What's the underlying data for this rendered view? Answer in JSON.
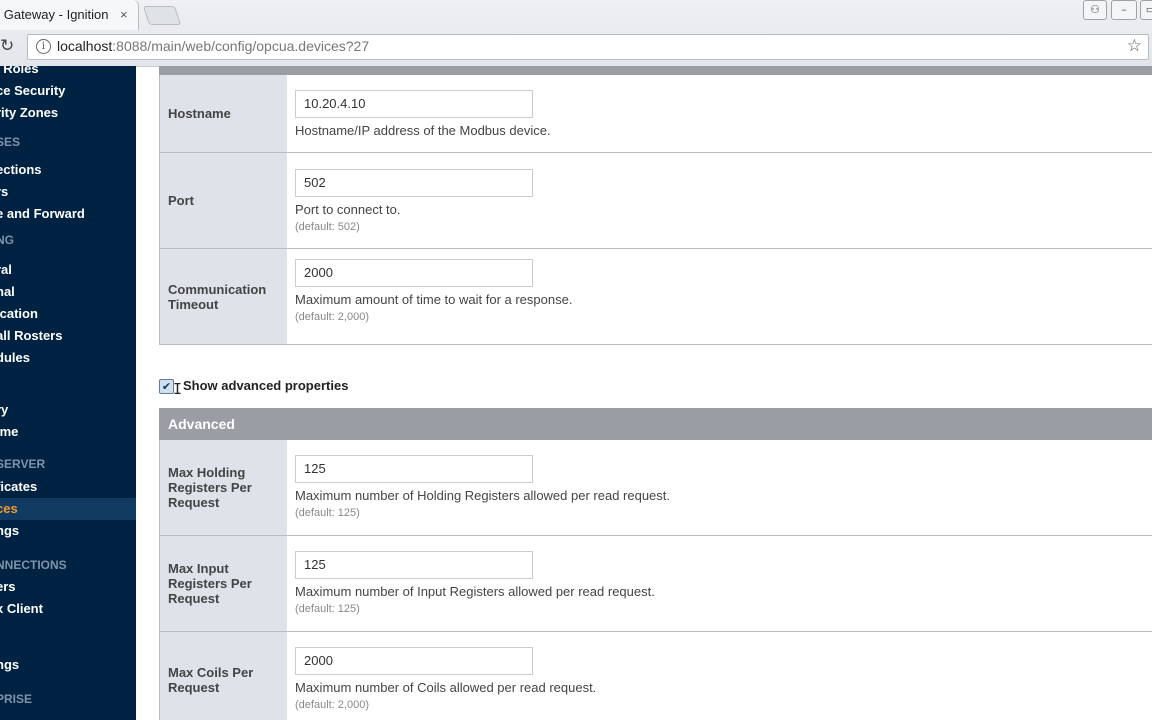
{
  "browser": {
    "tab_title": "al Gateway - Ignition",
    "tab_close": "×",
    "url_host": "localhost",
    "url_rest": ":8088/main/web/config/opcua.devices?27",
    "reload_glyph": "↻",
    "star_glyph": "☆",
    "info_glyph": "i",
    "profile_glyph": "⚇",
    "minimize_glyph": "–",
    "maximize_glyph": "▭",
    "close_glyph": "✕"
  },
  "sidebar": {
    "items": [
      {
        "label": ", Roles",
        "type": "link"
      },
      {
        "label": "ce Security",
        "type": "link"
      },
      {
        "label": "rity Zones",
        "type": "link"
      },
      {
        "label": "SES",
        "type": "header"
      },
      {
        "label": "ections",
        "type": "link"
      },
      {
        "label": "rs",
        "type": "link"
      },
      {
        "label": "e and Forward",
        "type": "link"
      },
      {
        "label": "NG",
        "type": "header"
      },
      {
        "label": "ral",
        "type": "link"
      },
      {
        "label": "nal",
        "type": "link"
      },
      {
        "label": "ication",
        "type": "link"
      },
      {
        "label": "all Rosters",
        "type": "link"
      },
      {
        "label": "dules",
        "type": "link"
      },
      {
        "label": "ry",
        "type": "link"
      },
      {
        "label": "ime",
        "type": "link"
      },
      {
        "label": " SERVER",
        "type": "header"
      },
      {
        "label": "ficates",
        "type": "link"
      },
      {
        "label": "ces",
        "type": "active"
      },
      {
        "label": "ngs",
        "type": "link"
      },
      {
        "label": "NNECTIONS",
        "type": "header"
      },
      {
        "label": "ers",
        "type": "link"
      },
      {
        "label": "x Client",
        "type": "link"
      },
      {
        "label": "ngs",
        "type": "link"
      },
      {
        "label": "PRISE",
        "type": "header"
      }
    ]
  },
  "form": {
    "rows": [
      {
        "label": "Hostname",
        "value": "10.20.4.10",
        "description": "Hostname/IP address of the Modbus device.",
        "default": ""
      },
      {
        "label": "Port",
        "value": "502",
        "description": "Port to connect to.",
        "default": "(default: 502)"
      },
      {
        "label": "Communication Timeout",
        "value": "2000",
        "description": "Maximum amount of time to wait for a response.",
        "default": "(default: 2,000)"
      }
    ],
    "show_advanced_label": "Show advanced properties",
    "show_advanced_checked": true,
    "check_glyph": "✔",
    "cursor_glyph": "I"
  },
  "advanced": {
    "title": "Advanced",
    "rows": [
      {
        "label": "Max Holding Registers Per Request",
        "value": "125",
        "description": "Maximum number of Holding Registers allowed per read request.",
        "default": "(default: 125)"
      },
      {
        "label": "Max Input Registers Per Request",
        "value": "125",
        "description": "Maximum number of Input Registers allowed per read request.",
        "default": "(default: 125)"
      },
      {
        "label": "Max Coils Per Request",
        "value": "2000",
        "description": "Maximum number of Coils allowed per read request.",
        "default": "(default: 2,000)"
      }
    ]
  }
}
